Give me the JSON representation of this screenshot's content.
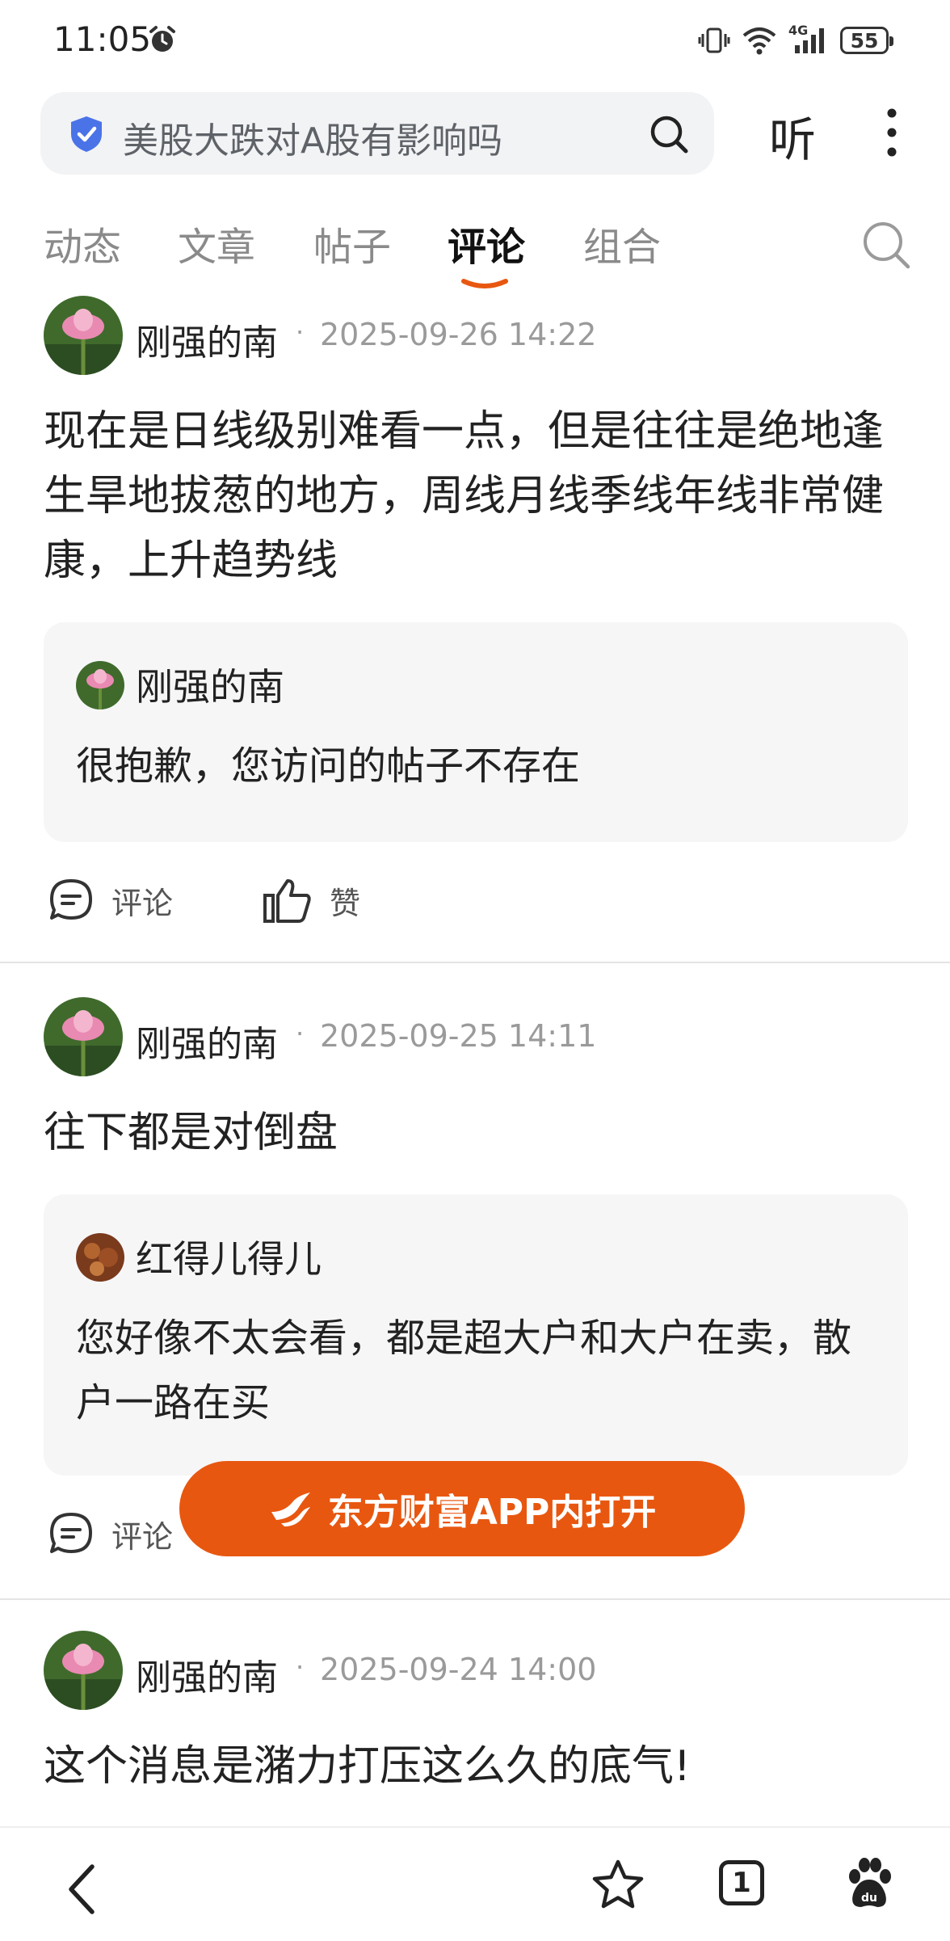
{
  "status_bar": {
    "time": "11:05",
    "network": "4G",
    "battery": "55"
  },
  "search": {
    "query": "美股大跌对A股有影响吗",
    "listen_label": "听"
  },
  "tabs": [
    {
      "label": "动态",
      "active": false
    },
    {
      "label": "文章",
      "active": false
    },
    {
      "label": "帖子",
      "active": false
    },
    {
      "label": "评论",
      "active": true
    },
    {
      "label": "组合",
      "active": false
    }
  ],
  "accent_color": "#e85710",
  "posts": [
    {
      "author": "刚强的南",
      "date": "2025-09-26 14:22",
      "content": "现在是日线级别难看一点，但是往往是绝地逢生旱地拔葱的地方，周线月线季线年线非常健康，上升趋势线",
      "quote": {
        "author": "刚强的南",
        "text": "很抱歉，您访问的帖子不存在"
      },
      "actions": {
        "comment": "评论",
        "like": "赞"
      }
    },
    {
      "author": "刚强的南",
      "date": "2025-09-25 14:11",
      "content": "往下都是对倒盘",
      "quote": {
        "author": "红得儿得儿",
        "text": "您好像不太会看，都是超大户和大户在卖，散户一路在买"
      },
      "actions": {
        "comment": "评论"
      }
    },
    {
      "author": "刚强的南",
      "date": "2025-09-24 14:00",
      "content": "这个消息是潴力打压这么久的底气!"
    }
  ],
  "open_app_button": "东方财富APP内打开",
  "bottom_bar": {
    "tab_count": "1"
  }
}
